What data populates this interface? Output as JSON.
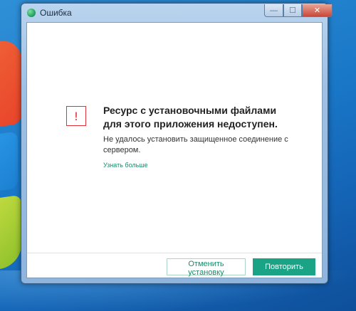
{
  "window": {
    "title": "Ошибка",
    "app_icon": "kaspersky-icon",
    "controls": {
      "minimize_glyph": "—",
      "maximize_glyph": "☐",
      "close_glyph": "✕"
    }
  },
  "dialog": {
    "warning_icon": "warning-icon",
    "warning_glyph": "!",
    "heading": "Ресурс с установочными файлами для этого приложения недоступен.",
    "message": "Не удалось установить защищенное соединение с сервером.",
    "learn_more": "Узнать больше",
    "cancel_label": "Отменить установку",
    "retry_label": "Повторить"
  },
  "colors": {
    "accent": "#1aa385",
    "link": "#1a8a6a",
    "warning": "#e0303a"
  }
}
